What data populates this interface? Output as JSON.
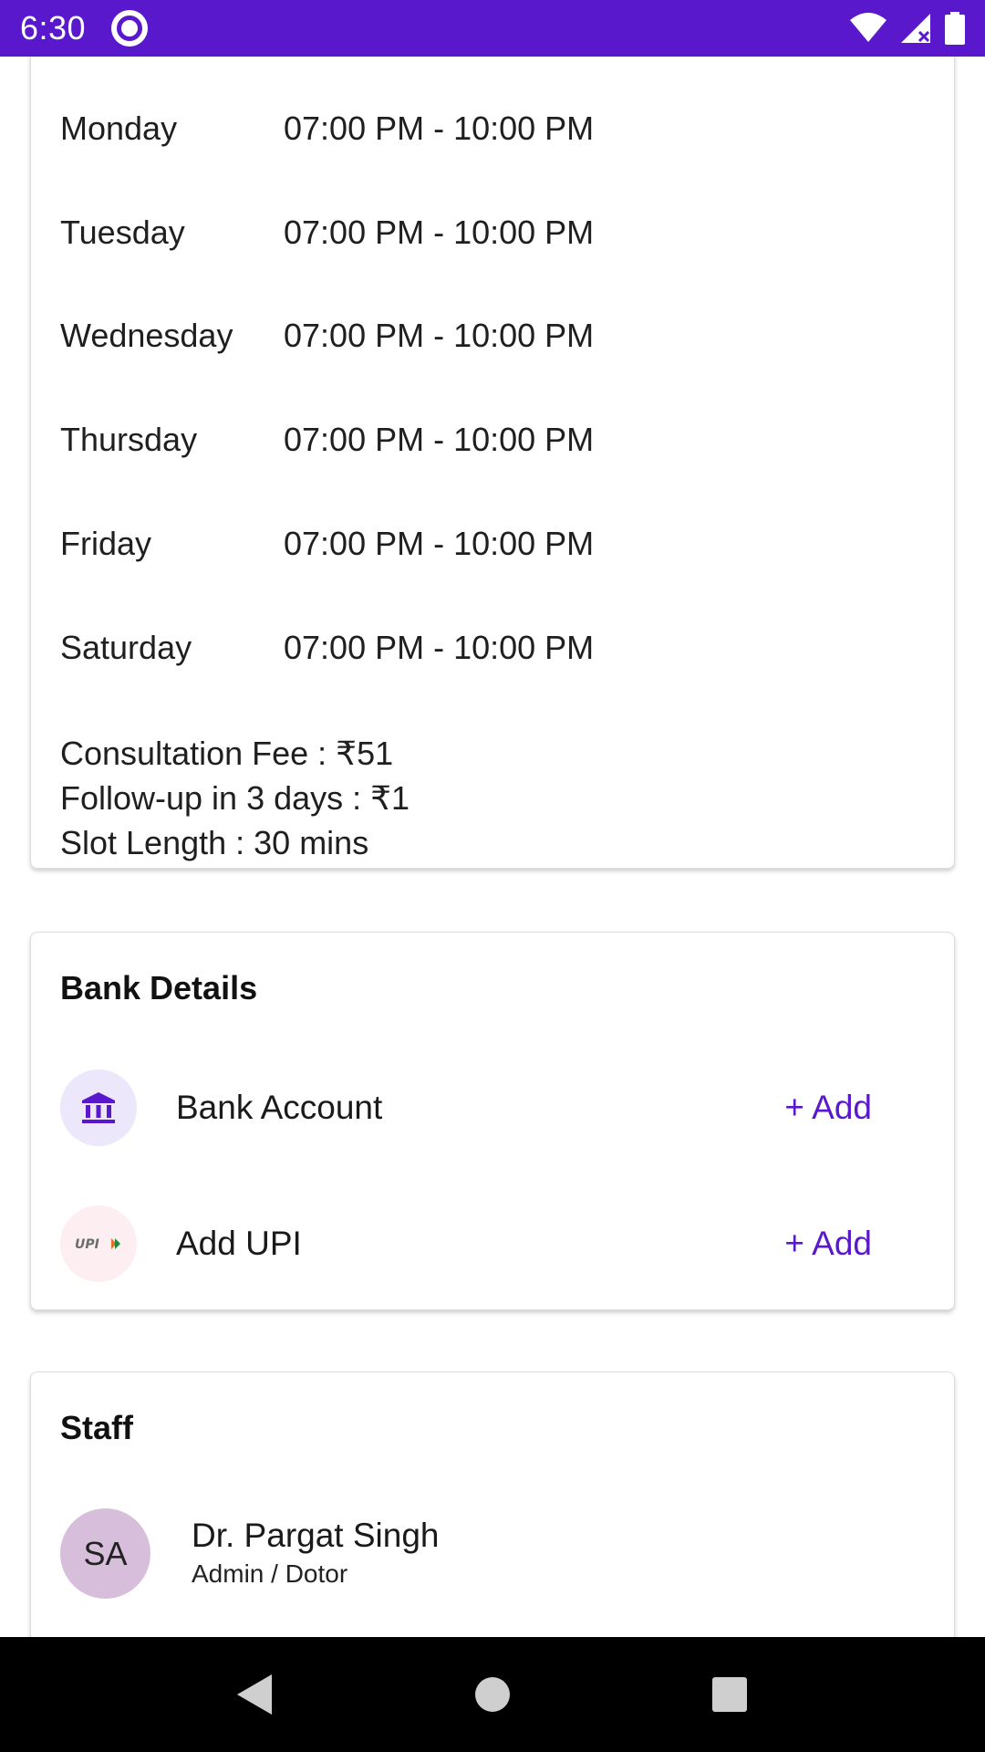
{
  "status_bar": {
    "time": "6:30"
  },
  "schedule": {
    "rows": [
      {
        "day": "Monday",
        "hours": "07:00 PM - 10:00 PM"
      },
      {
        "day": "Tuesday",
        "hours": "07:00 PM - 10:00 PM"
      },
      {
        "day": "Wednesday",
        "hours": "07:00 PM - 10:00 PM"
      },
      {
        "day": "Thursday",
        "hours": "07:00 PM - 10:00 PM"
      },
      {
        "day": "Friday",
        "hours": "07:00 PM - 10:00 PM"
      },
      {
        "day": "Saturday",
        "hours": "07:00 PM - 10:00 PM"
      }
    ],
    "consultation_fee": "Consultation Fee : ₹51",
    "follow_up": "Follow-up in 3 days : ₹1",
    "slot_length": "Slot Length : 30 mins"
  },
  "bank_details": {
    "title": "Bank Details",
    "items": [
      {
        "label": "Bank Account",
        "action": "+ Add",
        "icon": "bank-icon"
      },
      {
        "label": "Add UPI",
        "action": "+ Add",
        "icon": "upi-icon",
        "icon_text": "UPI"
      }
    ]
  },
  "staff": {
    "title": "Staff",
    "members": [
      {
        "initials": "SA",
        "name": "Dr. Pargat Singh",
        "role": "Admin / Dotor"
      }
    ]
  },
  "colors": {
    "accent": "#5a18cc",
    "avatar": "#d7bfdc"
  }
}
